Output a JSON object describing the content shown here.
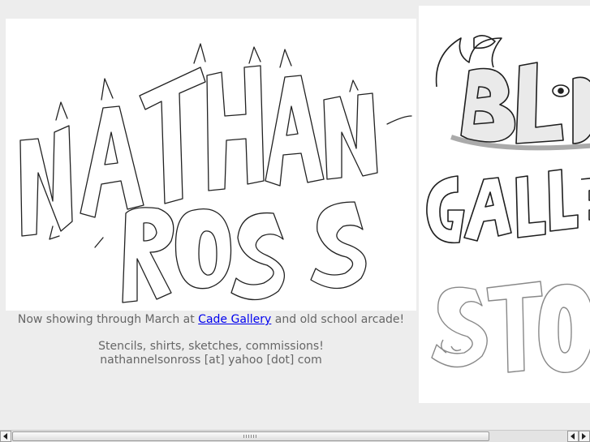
{
  "banner": {
    "alt": "Nathan Ross hand-drawn monster lettering logo"
  },
  "side_panel": {
    "alt": "Blog, Gallery, Store hand-drawn navigation lettering"
  },
  "caption": {
    "line1_prefix": "Now showing through March at",
    "gallery_link": "Cade Gallery",
    "line1_suffix": "and old school arcade!",
    "line2": "Stencils, shirts, sketches, commissions!",
    "line3": "nathannelsonross [at] yahoo [dot] com"
  },
  "scrollbar": {
    "orientation": "horizontal",
    "position": 0.0
  },
  "colors": {
    "page_bg": "#ededed",
    "text": "#666666",
    "link": "#0000ee"
  }
}
